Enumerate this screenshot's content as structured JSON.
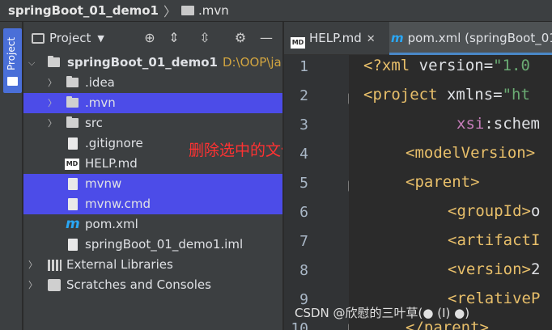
{
  "breadcrumb": {
    "project": "springBoot_01_demo1",
    "folder": ".mvn"
  },
  "tool_stripe": {
    "tab_label": "Project"
  },
  "project_panel": {
    "title": "Project",
    "root": {
      "name": "springBoot_01_demo1",
      "path": "D:\\OOP\\ja"
    },
    "items": [
      {
        "label": ".idea",
        "type": "folder",
        "selected": false
      },
      {
        "label": ".mvn",
        "type": "folder",
        "selected": true
      },
      {
        "label": "src",
        "type": "folder",
        "selected": false
      },
      {
        "label": ".gitignore",
        "type": "file",
        "selected": false
      },
      {
        "label": "HELP.md",
        "type": "markdown",
        "selected": false
      },
      {
        "label": "mvnw",
        "type": "file",
        "selected": true
      },
      {
        "label": "mvnw.cmd",
        "type": "file",
        "selected": true
      },
      {
        "label": "pom.xml",
        "type": "maven",
        "selected": false
      },
      {
        "label": "springBoot_01_demo1.iml",
        "type": "file",
        "selected": false
      }
    ],
    "external_libraries": "External Libraries",
    "scratches": "Scratches and Consoles"
  },
  "annotation": "删除选中的文件",
  "editor_tabs": [
    {
      "label": "HELP.md",
      "active": false
    },
    {
      "label": "pom.xml (springBoot_01",
      "active": true
    }
  ],
  "editor": {
    "line_numbers": [
      "1",
      "2",
      "3",
      "4",
      "5",
      "6",
      "7",
      "8",
      "9",
      "10"
    ],
    "lines": [
      {
        "tag": "<?xml ",
        "attr": "version=",
        "val": "\"1.0"
      },
      {
        "tag": "<project ",
        "attr": "xmlns=",
        "val": "\"ht"
      },
      {
        "ns": "xsi",
        "attr": ":schem"
      },
      {
        "tag": "<modelVersion>"
      },
      {
        "tag": "<parent>"
      },
      {
        "tag": "<groupId>",
        "text": "o"
      },
      {
        "tag": "<artifactI"
      },
      {
        "tag": "<version>",
        "text": "2"
      },
      {
        "tag": "<relativeP"
      },
      {
        "tag": "</parent>"
      }
    ]
  },
  "watermark": "CSDN @欣慰的三叶草(●  (I)  ●)",
  "colors": {
    "selection": "#4c4ce8",
    "annotation": "#ff3232",
    "panel_bg": "#3c3f41",
    "editor_bg": "#2b2b2b"
  }
}
